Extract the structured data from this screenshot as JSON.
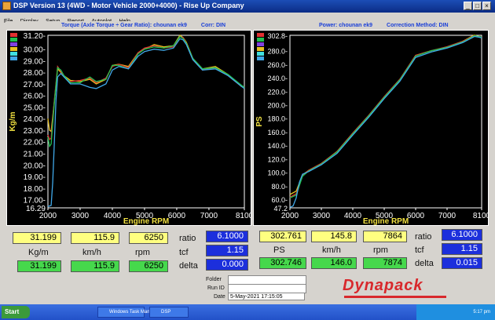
{
  "window": {
    "title": "DSP Version 13 (4WD - Motor Vehicle 2000+4000) - Rise Up Company",
    "min_label": "_",
    "max_label": "□",
    "close_label": "×"
  },
  "menu": [
    "File",
    "Display",
    "Setup",
    "Report",
    "Autoplot",
    "Help"
  ],
  "left_chart": {
    "header": "Torque (Axle Torque ÷ Gear Ratio): chounan ek9",
    "corr": "Corr: DIN"
  },
  "right_chart": {
    "header": "Power: chounan ek9",
    "corr": "Correction Method: DIN"
  },
  "chart_data": [
    {
      "type": "line",
      "xlabel": "Engine RPM",
      "ylabel": "Kg/m",
      "xlim": [
        2000,
        8100
      ],
      "ylim": [
        16.29,
        31.2
      ],
      "x_ticks": [
        "2000",
        "3000",
        "4000",
        "5000",
        "6000",
        "7000",
        "8100"
      ],
      "y_ticks": [
        "31.20-",
        "30.00-",
        "29.00-",
        "28.00-",
        "27.00-",
        "26.00-",
        "25.00-",
        "24.00-",
        "23.00-",
        "22.00-",
        "21.00-",
        "20.00-",
        "19.00-",
        "18.00-",
        "17.00-",
        "16.29"
      ],
      "series": [
        {
          "color": "#e8c020",
          "x": [
            2000,
            2050,
            2100,
            2200,
            2300,
            2400,
            2500,
            2700,
            3000,
            3300,
            3500,
            3800,
            4000,
            4200,
            4500,
            4800,
            5000,
            5300,
            5600,
            5900,
            6100,
            6200,
            6300,
            6500,
            6800,
            7200,
            7600,
            8000,
            8100
          ],
          "y": [
            24.0,
            23.0,
            22.9,
            25.5,
            28.3,
            28.0,
            27.7,
            27.3,
            27.2,
            27.4,
            27.0,
            27.4,
            28.6,
            28.7,
            28.5,
            29.7,
            30.0,
            30.4,
            30.2,
            30.3,
            31.2,
            31.0,
            30.6,
            29.2,
            28.3,
            28.5,
            27.8,
            26.8,
            26.7
          ]
        },
        {
          "color": "#e03030",
          "x": [
            2000,
            2050,
            2100,
            2200,
            2300,
            2400,
            2500,
            2700,
            3000,
            3300,
            3500,
            3800,
            4000,
            4200,
            4500,
            4800,
            5000,
            5300,
            5600,
            5900,
            6100,
            6200,
            6300,
            6500,
            6800,
            7200,
            7600,
            8000,
            8100
          ],
          "y": [
            22.6,
            22.2,
            22.3,
            25.6,
            28.5,
            28.1,
            27.6,
            27.2,
            27.3,
            27.5,
            27.1,
            27.5,
            28.5,
            28.7,
            28.4,
            29.7,
            30.1,
            30.3,
            30.1,
            30.2,
            31.1,
            31.0,
            30.5,
            29.1,
            28.2,
            28.4,
            27.7,
            26.8,
            26.7
          ]
        },
        {
          "color": "#20c050",
          "x": [
            2000,
            2050,
            2100,
            2200,
            2300,
            2400,
            2500,
            2700,
            3000,
            3300,
            3500,
            3800,
            4000,
            4200,
            4500,
            4800,
            5000,
            5300,
            5600,
            5900,
            6100,
            6200,
            6300,
            6500,
            6800,
            7200,
            7600,
            8000,
            8100
          ],
          "y": [
            22.4,
            21.6,
            21.8,
            25.4,
            28.4,
            28.2,
            27.7,
            27.1,
            27.1,
            27.6,
            27.2,
            27.4,
            28.6,
            28.6,
            28.3,
            29.6,
            30.0,
            30.2,
            30.1,
            30.3,
            31.1,
            30.9,
            30.5,
            29.2,
            28.3,
            28.4,
            27.8,
            26.9,
            26.7
          ]
        },
        {
          "color": "#40a8e8",
          "x": [
            2000,
            2100,
            2150,
            2200,
            2250,
            2300,
            2400,
            2500,
            2700,
            3000,
            3300,
            3500,
            3800,
            4000,
            4200,
            4500,
            4800,
            5000,
            5300,
            5600,
            5900,
            6100,
            6200,
            6300,
            6500,
            6800,
            7200,
            7600,
            8000,
            8100
          ],
          "y": [
            16.4,
            16.5,
            18.5,
            22.0,
            25.5,
            27.6,
            27.9,
            27.6,
            27.0,
            27.0,
            26.7,
            26.6,
            27.0,
            28.2,
            28.5,
            28.3,
            29.4,
            29.8,
            30.0,
            29.9,
            30.1,
            30.9,
            30.8,
            30.4,
            29.1,
            28.2,
            28.3,
            27.7,
            26.8,
            26.6
          ]
        }
      ]
    },
    {
      "type": "line",
      "xlabel": "Engine RPM",
      "ylabel": "PS",
      "xlim": [
        2000,
        8100
      ],
      "ylim": [
        47.2,
        302.8
      ],
      "x_ticks": [
        "2000",
        "3000",
        "4000",
        "5000",
        "6000",
        "7000",
        "8100"
      ],
      "y_ticks": [
        "302.8-",
        "280.0-",
        "260.0-",
        "240.0-",
        "220.0-",
        "200.0-",
        "180.0-",
        "160.0-",
        "140.0-",
        "120.0-",
        "100.0-",
        "80.0-",
        "60.0-",
        "47.2"
      ],
      "series": [
        {
          "color": "#e8c020",
          "x": [
            2000,
            2200,
            2400,
            2600,
            3000,
            3500,
            4000,
            4500,
            5000,
            5500,
            6000,
            6500,
            7000,
            7500,
            7860,
            8000,
            8100
          ],
          "y": [
            67,
            72,
            96,
            103,
            113,
            130,
            157,
            183,
            211,
            237,
            273,
            280,
            285,
            294,
            303,
            301,
            300
          ]
        },
        {
          "color": "#e03030",
          "x": [
            2000,
            2200,
            2400,
            2600,
            3000,
            3500,
            4000,
            4500,
            5000,
            5500,
            6000,
            6500,
            7000,
            7500,
            7860,
            8000,
            8100
          ],
          "y": [
            63,
            68,
            95,
            103,
            113,
            131,
            158,
            184,
            212,
            238,
            273,
            280,
            286,
            294,
            302,
            301,
            300
          ]
        },
        {
          "color": "#20c050",
          "x": [
            2000,
            2200,
            2400,
            2600,
            3000,
            3500,
            4000,
            4500,
            5000,
            5500,
            6000,
            6500,
            7000,
            7500,
            7870,
            8000,
            8100
          ],
          "y": [
            62,
            66,
            94,
            102,
            112,
            130,
            157,
            183,
            211,
            237,
            272,
            280,
            285,
            293,
            302,
            301,
            300
          ]
        },
        {
          "color": "#40a8e8",
          "x": [
            2000,
            2100,
            2200,
            2300,
            2400,
            2600,
            3000,
            3500,
            4000,
            4500,
            5000,
            5500,
            6000,
            6500,
            7000,
            7500,
            7870,
            8000,
            8100
          ],
          "y": [
            48,
            50,
            62,
            85,
            97,
            101,
            111,
            128,
            155,
            181,
            209,
            235,
            270,
            278,
            284,
            292,
            301,
            300,
            299
          ]
        }
      ]
    }
  ],
  "readouts": {
    "left": {
      "max_torque": "31.199",
      "max_speed": "115.9",
      "max_rpm": "6250",
      "unit_torque": "Kg/m",
      "unit_speed": "km/h",
      "unit_rpm": "rpm",
      "cur_torque": "31.199",
      "cur_speed": "115.9",
      "cur_rpm": "6250",
      "ratio_label": "ratio",
      "ratio": "6.1000",
      "tcf_label": "tcf",
      "tcf": "1.15",
      "delta_label": "delta",
      "delta": "0.000"
    },
    "right": {
      "max_power": "302.761",
      "max_speed": "145.8",
      "max_rpm": "7864",
      "unit_power": "PS",
      "unit_speed": "km/h",
      "unit_rpm": "rpm",
      "cur_power": "302.746",
      "cur_speed": "146.0",
      "cur_rpm": "7874",
      "ratio_label": "ratio",
      "ratio": "6.1000",
      "tcf_label": "tcf",
      "tcf": "1.15",
      "delta_label": "delta",
      "delta": "0.015"
    }
  },
  "info": {
    "folder_label": "Folder",
    "folder_value": "",
    "runid_label": "Run ID",
    "runid_value": "",
    "date_label": "Date",
    "date_value": "5-May-2021 17:15:05"
  },
  "logo": "Dynapack",
  "taskbar": {
    "start": "Start",
    "tasks": [
      "Windows Task Manager",
      "DSP"
    ],
    "clock": "5:17 pm"
  }
}
